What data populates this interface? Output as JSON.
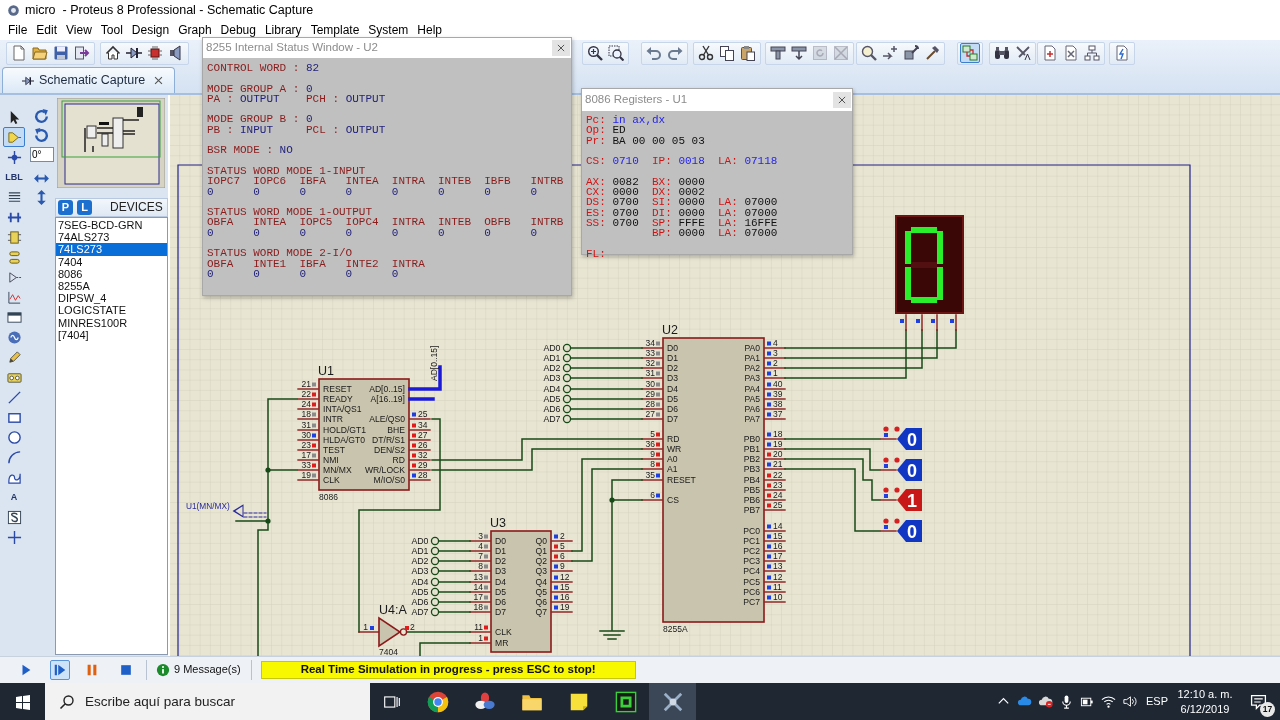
{
  "window": {
    "title": "micro  - Proteus 8 Professional - Schematic Capture"
  },
  "menu": [
    "File",
    "Edit",
    "View",
    "Tool",
    "Design",
    "Graph",
    "Debug",
    "Library",
    "Template",
    "System",
    "Help"
  ],
  "toolbar": [
    {
      "selected": false,
      "disabled": false
    },
    {
      "selected": false,
      "disabled": false
    },
    {
      "selected": false,
      "disabled": false
    },
    {
      "selected": false,
      "disabled": false
    },
    {
      "selected": false,
      "disabled": false
    },
    {
      "selected": false,
      "disabled": false
    },
    {
      "selected": false,
      "disabled": false
    },
    {
      "selected": false,
      "disabled": false
    },
    {
      "selected": false,
      "disabled": false
    },
    {
      "selected": false,
      "disabled": false
    },
    {
      "selected": false,
      "disabled": false
    },
    {
      "selected": false,
      "disabled": false
    },
    {
      "selected": false,
      "disabled": false
    },
    {
      "selected": false,
      "disabled": false
    },
    {
      "selected": false,
      "disabled": false
    },
    {
      "selected": false,
      "disabled": false
    },
    {
      "selected": false,
      "disabled": false
    },
    {
      "selected": false,
      "disabled": true
    },
    {
      "selected": false,
      "disabled": true
    },
    {
      "selected": false,
      "disabled": false
    },
    {
      "selected": false,
      "disabled": false
    },
    {
      "selected": false,
      "disabled": false
    },
    {
      "selected": false,
      "disabled": false
    },
    {
      "selected": true,
      "disabled": false
    },
    {
      "selected": false,
      "disabled": false
    },
    {
      "selected": false,
      "disabled": false
    },
    {
      "selected": false,
      "disabled": false
    },
    {
      "selected": false,
      "disabled": false
    },
    {
      "selected": false,
      "disabled": false
    },
    {
      "selected": false,
      "disabled": false
    }
  ],
  "tab": {
    "label": "Schematic Capture",
    "selected": true
  },
  "tools": [
    {
      "selected": false
    },
    {
      "selected": true
    },
    {
      "selected": false
    },
    {
      "glyph": "LBL",
      "selected": false
    },
    {
      "selected": false
    },
    {
      "selected": false
    },
    {
      "selected": false
    },
    {
      "selected": false
    },
    {
      "selected": false
    },
    {
      "selected": false
    },
    {
      "selected": false
    },
    {
      "selected": false
    },
    {
      "selected": false
    },
    {
      "selected": false
    },
    {
      "selected": false
    },
    {
      "selected": false
    },
    {
      "selected": false
    },
    {
      "selected": false
    },
    {
      "selected": false
    },
    {
      "glyph": "A",
      "selected": false
    },
    {
      "selected": false
    },
    {
      "selected": false
    }
  ],
  "rotation": {
    "value": "0°"
  },
  "devices": {
    "buttons": [
      "P",
      "L"
    ],
    "title": "DEVICES",
    "items": [
      {
        "label": "7SEG-BCD-GRN",
        "selected": false
      },
      {
        "label": "74ALS273",
        "selected": false
      },
      {
        "label": "74LS273",
        "selected": true
      },
      {
        "label": "7404",
        "selected": false
      },
      {
        "label": "8086",
        "selected": false
      },
      {
        "label": "8255A",
        "selected": false
      },
      {
        "label": "DIPSW_4",
        "selected": false
      },
      {
        "label": "LOGICSTATE",
        "selected": false
      },
      {
        "label": "MINRES100R",
        "selected": false
      },
      {
        "label": "[7404]",
        "selected": false
      }
    ]
  },
  "schematic": {
    "chips": [
      {
        "ref": "U1",
        "part": "8086",
        "buses": [
          "AD[0..15]",
          "A[16..19]"
        ],
        "left": [
          {
            "number": "21",
            "label": "RESET",
            "color": "#8a8a8a"
          },
          {
            "number": "22",
            "label": "READY",
            "color": "#e01c1c"
          },
          {
            "number": "24",
            "label": "INTA/QS1",
            "color": "#e01c1c"
          },
          {
            "number": "18",
            "label": "INTR",
            "color": "#8a8a8a"
          },
          {
            "number": "31",
            "label": "HOLD/GT1",
            "color": "#8a8a8a"
          },
          {
            "number": "30",
            "label": "HLDA/GT0",
            "color": "#1f3fe0"
          },
          {
            "number": "23",
            "label": "TEST",
            "color": "#e01c1c"
          },
          {
            "number": "17",
            "label": "NMI",
            "color": "#8a8a8a"
          },
          {
            "number": "33",
            "label": "MN/MX",
            "color": "#e01c1c"
          },
          {
            "number": "19",
            "label": "CLK",
            "color": "#8a8a8a"
          }
        ],
        "right": [
          {
            "number": "25",
            "label": "ALE/QS0",
            "color": "#1f3fe0"
          },
          {
            "number": "34",
            "label": "BHE",
            "color": "#e01c1c"
          },
          {
            "number": "27",
            "label": "DT/R/S1",
            "color": "#e01c1c"
          },
          {
            "number": "26",
            "label": "DEN/S2",
            "color": "#e01c1c"
          },
          {
            "number": "32",
            "label": "RD",
            "color": "#e01c1c"
          },
          {
            "number": "29",
            "label": "WR/LOCK",
            "color": "#e01c1c"
          },
          {
            "number": "28",
            "label": "M/IO/S0",
            "color": "#1f3fe0"
          }
        ]
      },
      {
        "ref": "U2",
        "part": "8255A",
        "left": [
          {
            "number": "34",
            "label": "D0",
            "color": "#8a8a8a"
          },
          {
            "number": "33",
            "label": "D1",
            "color": "#8a8a8a"
          },
          {
            "number": "32",
            "label": "D2",
            "color": "#8a8a8a"
          },
          {
            "number": "31",
            "label": "D3",
            "color": "#8a8a8a"
          },
          {
            "number": "30",
            "label": "D4",
            "color": "#8a8a8a"
          },
          {
            "number": "29",
            "label": "D5",
            "color": "#8a8a8a"
          },
          {
            "number": "28",
            "label": "D6",
            "color": "#8a8a8a"
          },
          {
            "number": "27",
            "label": "D7",
            "color": "#8a8a8a"
          },
          {
            "number": "5",
            "label": "RD",
            "color": "#e01c1c"
          },
          {
            "number": "36",
            "label": "WR",
            "color": "#e01c1c"
          },
          {
            "number": "9",
            "label": "A0",
            "color": "#e01c1c"
          },
          {
            "number": "8",
            "label": "A1",
            "color": "#e01c1c"
          },
          {
            "number": "35",
            "label": "RESET",
            "color": "#1f3fe0"
          },
          {
            "number": "6",
            "label": "CS",
            "color": "#1f3fe0"
          }
        ],
        "right": [
          {
            "number": "4",
            "label": "PA0",
            "color": "#1f3fe0"
          },
          {
            "number": "3",
            "label": "PA1",
            "color": "#1f3fe0"
          },
          {
            "number": "2",
            "label": "PA2",
            "color": "#1f3fe0"
          },
          {
            "number": "1",
            "label": "PA3",
            "color": "#1f3fe0"
          },
          {
            "number": "40",
            "label": "PA4",
            "color": "#1f3fe0"
          },
          {
            "number": "39",
            "label": "PA5",
            "color": "#1f3fe0"
          },
          {
            "number": "38",
            "label": "PA6",
            "color": "#1f3fe0"
          },
          {
            "number": "37",
            "label": "PA7",
            "color": "#1f3fe0"
          },
          {
            "number": "18",
            "label": "PB0",
            "color": "#1f3fe0"
          },
          {
            "number": "19",
            "label": "PB1",
            "color": "#1f3fe0"
          },
          {
            "number": "20",
            "label": "PB2",
            "color": "#e01c1c"
          },
          {
            "number": "21",
            "label": "PB3",
            "color": "#1f3fe0"
          },
          {
            "number": "22",
            "label": "PB4",
            "color": "#e01c1c"
          },
          {
            "number": "23",
            "label": "PB5",
            "color": "#e01c1c"
          },
          {
            "number": "24",
            "label": "PB6",
            "color": "#e01c1c"
          },
          {
            "number": "25",
            "label": "PB7",
            "color": "#e01c1c"
          },
          {
            "number": "14",
            "label": "PC0",
            "color": "#1f3fe0"
          },
          {
            "number": "15",
            "label": "PC1",
            "color": "#1f3fe0"
          },
          {
            "number": "16",
            "label": "PC2",
            "color": "#1f3fe0"
          },
          {
            "number": "17",
            "label": "PC3",
            "color": "#1f3fe0"
          },
          {
            "number": "13",
            "label": "PC4",
            "color": "#1f3fe0"
          },
          {
            "number": "12",
            "label": "PC5",
            "color": "#1f3fe0"
          },
          {
            "number": "11",
            "label": "PC6",
            "color": "#1f3fe0"
          },
          {
            "number": "10",
            "label": "PC7",
            "color": "#1f3fe0"
          }
        ]
      },
      {
        "ref": "U3",
        "left": [
          {
            "number": "3",
            "label": "D0",
            "color": "#8a8a8a"
          },
          {
            "number": "4",
            "label": "D1",
            "color": "#8a8a8a"
          },
          {
            "number": "7",
            "label": "D2",
            "color": "#8a8a8a"
          },
          {
            "number": "8",
            "label": "D3",
            "color": "#8a8a8a"
          },
          {
            "number": "13",
            "label": "D4",
            "color": "#8a8a8a"
          },
          {
            "number": "14",
            "label": "D5",
            "color": "#8a8a8a"
          },
          {
            "number": "17",
            "label": "D6",
            "color": "#8a8a8a"
          },
          {
            "number": "18",
            "label": "D7",
            "color": "#8a8a8a"
          },
          {
            "number": "11",
            "label": "CLK",
            "color": "#e01c1c"
          },
          {
            "number": "1",
            "label": "MR",
            "color": "#e01c1c"
          }
        ],
        "right": [
          {
            "number": "2",
            "label": "Q0",
            "color": "#1f3fe0"
          },
          {
            "number": "5",
            "label": "Q1",
            "color": "#e01c1c"
          },
          {
            "number": "6",
            "label": "Q2",
            "color": "#e01c1c"
          },
          {
            "number": "9",
            "label": "Q3",
            "color": "#1f3fe0"
          },
          {
            "number": "12",
            "label": "Q4",
            "color": "#1f3fe0"
          },
          {
            "number": "15",
            "label": "Q5",
            "color": "#1f3fe0"
          },
          {
            "number": "16",
            "label": "Q6",
            "color": "#1f3fe0"
          },
          {
            "number": "19",
            "label": "Q7",
            "color": "#1f3fe0"
          }
        ]
      }
    ],
    "bus_label": "AD[0..15]",
    "gate": {
      "ref": "U4:A",
      "part": "7404",
      "pins": [
        {
          "number": "1",
          "color": "#1f3fe0"
        },
        {
          "number": "2",
          "color": "#e01c1c"
        }
      ]
    },
    "probe": "U1(MN/MX)",
    "terminal_groups": [
      [
        "AD0",
        "AD1",
        "AD2",
        "AD3",
        "AD4",
        "AD5",
        "AD6",
        "AD7"
      ],
      [
        "AD0",
        "AD1",
        "AD2",
        "AD3",
        "AD4",
        "AD5",
        "AD6",
        "AD7"
      ]
    ],
    "display": {
      "segments": [
        true,
        true,
        true,
        true,
        true,
        true,
        false
      ],
      "pins": [
        {
          "color": "#1f3fe0"
        },
        {
          "color": "#1f3fe0"
        },
        {
          "color": "#1f3fe0"
        },
        {
          "color": "#1f3fe0"
        }
      ]
    },
    "logic_states": [
      {
        "value": "0",
        "color": "#1236c4",
        "pin": {
          "color": "#1f3fe0"
        }
      },
      {
        "value": "0",
        "color": "#1236c4",
        "pin": {
          "color": "#1f3fe0"
        }
      },
      {
        "value": "1",
        "color": "#c81818",
        "pin": {
          "color": "#1f3fe0"
        }
      },
      {
        "value": "0",
        "color": "#1236c4",
        "pin": {
          "color": "#1f3fe0"
        }
      }
    ]
  },
  "status_window": {
    "title": "8255 Internal Status Window - U2",
    "sections": [
      {
        "kind": "pairs",
        "rows": [
          [
            {
              "label": "CONTROL WORD :",
              "value": "82"
            }
          ]
        ]
      },
      {
        "kind": "pairs",
        "rows": [
          [
            {
              "label": "MODE GROUP A :",
              "value": "0"
            }
          ],
          [
            {
              "label": "PA :",
              "value": "OUTPUT"
            },
            {
              "label": "PCH :",
              "value": "OUTPUT"
            }
          ]
        ]
      },
      {
        "kind": "pairs",
        "rows": [
          [
            {
              "label": "MODE GROUP B :",
              "value": "0"
            }
          ],
          [
            {
              "label": "PB :",
              "value": "INPUT"
            },
            {
              "label": "PCL :",
              "value": "OUTPUT"
            }
          ]
        ]
      },
      {
        "kind": "pairs",
        "rows": [
          [
            {
              "label": "BSR MODE :",
              "value": "NO"
            }
          ]
        ]
      },
      {
        "kind": "table",
        "heading": "STATUS WORD MODE 1-INPUT",
        "columns": [
          {
            "name": "IOPC7",
            "value": "0"
          },
          {
            "name": "IOPC6",
            "value": "0"
          },
          {
            "name": "IBFA",
            "value": "0"
          },
          {
            "name": "INTEA",
            "value": "0"
          },
          {
            "name": "INTRA",
            "value": "0"
          },
          {
            "name": "INTEB",
            "value": "0"
          },
          {
            "name": "IBFB",
            "value": "0"
          },
          {
            "name": "INTRB",
            "value": "0"
          }
        ]
      },
      {
        "kind": "table",
        "heading": "STATUS WORD MODE 1-OUTPUT",
        "columns": [
          {
            "name": "OBFA",
            "value": "0"
          },
          {
            "name": "INTEA",
            "value": "0"
          },
          {
            "name": "IOPC5",
            "value": "0"
          },
          {
            "name": "IOPC4",
            "value": "0"
          },
          {
            "name": "INTRA",
            "value": "0"
          },
          {
            "name": "INTEB",
            "value": "0"
          },
          {
            "name": "OBFB",
            "value": "0"
          },
          {
            "name": "INTRB",
            "value": "0"
          }
        ]
      },
      {
        "kind": "table",
        "heading": "STATUS WORD MODE 2-I/O",
        "columns": [
          {
            "name": "OBFA",
            "value": "0"
          },
          {
            "name": "INTE1",
            "value": "0"
          },
          {
            "name": "IBFA",
            "value": "0"
          },
          {
            "name": "INTE2",
            "value": "0"
          },
          {
            "name": "INTRA",
            "value": "0"
          }
        ]
      }
    ]
  },
  "registers_window": {
    "title": "8086 Registers - U1",
    "sections": [
      [
        {
          "emphasis": true,
          "cells": [
            {
              "name": "Pc:",
              "value": "in ax,dx"
            }
          ]
        },
        {
          "emphasis": false,
          "cells": [
            {
              "name": "Op:",
              "value": "ED"
            }
          ]
        },
        {
          "emphasis": false,
          "cells": [
            {
              "name": "Pr:",
              "value": "BA 00 00 05 03"
            }
          ]
        }
      ],
      [
        {
          "emphasis": true,
          "cells": [
            {
              "name": "CS:",
              "value": "0710"
            },
            {
              "name": "IP:",
              "value": "0018"
            },
            {
              "name": "LA:",
              "value": "07118"
            }
          ]
        }
      ],
      [
        {
          "emphasis": false,
          "cells": [
            {
              "name": "AX:",
              "value": "0082"
            },
            {
              "name": "BX:",
              "value": "0000"
            }
          ]
        },
        {
          "emphasis": false,
          "cells": [
            {
              "name": "CX:",
              "value": "0000"
            },
            {
              "name": "DX:",
              "value": "0002"
            }
          ]
        },
        {
          "emphasis": false,
          "cells": [
            {
              "name": "DS:",
              "value": "0700"
            },
            {
              "name": "SI:",
              "value": "0000"
            },
            {
              "name": "LA:",
              "value": "07000"
            }
          ]
        },
        {
          "emphasis": false,
          "cells": [
            {
              "name": "ES:",
              "value": "0700"
            },
            {
              "name": "DI:",
              "value": "0000"
            },
            {
              "name": "LA:",
              "value": "07000"
            }
          ]
        },
        {
          "emphasis": false,
          "cells": [
            {
              "name": "SS:",
              "value": "0700"
            },
            {
              "name": "SP:",
              "value": "FFFE"
            },
            {
              "name": "LA:",
              "value": "16FFE"
            }
          ]
        },
        {
          "emphasis": false,
          "cells": [
            null,
            {
              "name": "BP:",
              "value": "0000"
            },
            {
              "name": "LA:",
              "value": "07000"
            }
          ]
        }
      ],
      [
        {
          "cells": [
            {
              "name": "FL:"
            }
          ]
        }
      ]
    ]
  },
  "simulation": {
    "controls": [
      {
        "highlighted": false
      },
      {
        "highlighted": true
      },
      {
        "highlighted": false
      },
      {
        "highlighted": false
      }
    ],
    "messages": "9 Message(s)",
    "status": "Real Time Simulation in progress - press ESC to stop!"
  },
  "taskbar": {
    "search": {
      "placeholder": "Escribe aquí para buscar"
    },
    "apps": [
      {
        "selected": false
      },
      {
        "selected": false
      },
      {
        "selected": false
      },
      {
        "selected": false
      },
      {
        "selected": false
      },
      {
        "selected": true
      }
    ],
    "language": "ESP",
    "time": "12:10 a. m.",
    "date": "6/12/2019",
    "notifications": "17"
  }
}
